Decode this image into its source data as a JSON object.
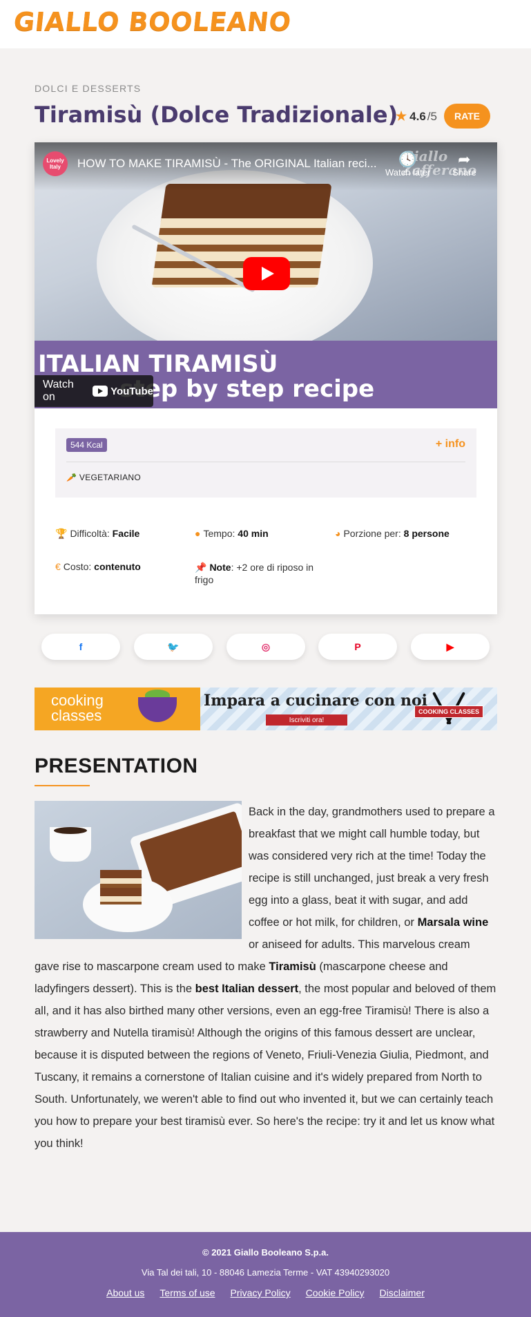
{
  "header": {
    "logo_text": "GIALLO BOOLEANO"
  },
  "recipe": {
    "category": "DOLCI E DESSERTS",
    "title": "Tiramisù (Dolce Tradizionale)",
    "rating_value": "4.6",
    "rating_denominator": "/5",
    "rate_button_label": "RATE"
  },
  "video": {
    "channel_badge": "Lovely Italy",
    "title": "HOW TO MAKE TIRAMISÙ - The ORIGINAL Italian reci...",
    "watch_later_label": "Watch later",
    "share_label": "Share",
    "watermark": "Giallo Zafferano",
    "banner_line1": "ITALIAN TIRAMISÙ",
    "banner_line2": "step by step recipe",
    "watch_on_label": "Watch on",
    "youtube_label": "YouTube"
  },
  "nutrition": {
    "kcal_badge": "544 Kcal",
    "more_info_label": "+ info",
    "diet_tag": "VEGETARIANO"
  },
  "details": [
    {
      "icon": "trophy-icon",
      "label": "Difficoltà:",
      "value": "Facile"
    },
    {
      "icon": "clock-icon",
      "label": "Tempo:",
      "value": "40 min"
    },
    {
      "icon": "pie-icon",
      "label": "Porzione per:",
      "value": "8 persone"
    },
    {
      "icon": "euro-icon",
      "label": "Costo:",
      "value": "contenuto"
    },
    {
      "icon": "pin-icon",
      "label": "Note",
      "value": ": +2 ore di riposo in frigo"
    }
  ],
  "social": [
    {
      "name": "facebook",
      "glyph": "f",
      "color": "#1877f2"
    },
    {
      "name": "twitter",
      "glyph": "🐦",
      "color": "#1da1f2"
    },
    {
      "name": "instagram",
      "glyph": "◎",
      "color": "#e1306c"
    },
    {
      "name": "pinterest",
      "glyph": "P",
      "color": "#e60023"
    },
    {
      "name": "youtube",
      "glyph": "▶",
      "color": "#ff0000"
    }
  ],
  "ad": {
    "left_line1": "cooking",
    "left_line2": "classes",
    "headline": "Impara a cucinare con noi",
    "cta": "Iscriviti ora!",
    "ribbon": "COOKING CLASSES"
  },
  "presentation": {
    "heading": "PRESENTATION",
    "p1": "Back in the day, grandmothers used to prepare a breakfast that we might call humble today, but was considered very rich at the time! Today the recipe is still unchanged, just break a very fresh egg into a glass, beat it with sugar, and add coffee or hot milk, for children, or ",
    "b1": "Marsala wine",
    "p2": " or aniseed for adults. This marvelous cream gave rise to mascarpone cream used to make ",
    "b2": "Tiramisù",
    "p3": " (mascarpone cheese and ladyfingers dessert). This is the ",
    "b3": "best Italian dessert",
    "p4": ", the most popular and beloved of them all, and it has also birthed many other versions, even an egg-free Tiramisù! There is also a strawberry and Nutella tiramisù! Although the origins of this famous dessert are unclear, because it is disputed between the regions of Veneto, Friuli-Venezia Giulia, Piedmont, and Tuscany, it remains a cornerstone of Italian cuisine and it's widely prepared from North to South. Unfortunately, we weren't able to find out who invented it, but we can certainly teach you how to prepare your best tiramisù ever. So here's the recipe: try it and let us know what you think!"
  },
  "footer": {
    "copyright": "© 2021 Giallo Booleano S.p.a.",
    "address": "Via Tal dei tali, 10 - 88046 Lamezia Terme - VAT 43940293020",
    "links": [
      "About us",
      "Terms of use",
      "Privacy Policy",
      "Cookie Policy",
      "Disclaimer"
    ]
  },
  "colors": {
    "accent": "#f5921e",
    "brand_purple": "#7b64a3",
    "title_purple": "#4a3b6e"
  }
}
